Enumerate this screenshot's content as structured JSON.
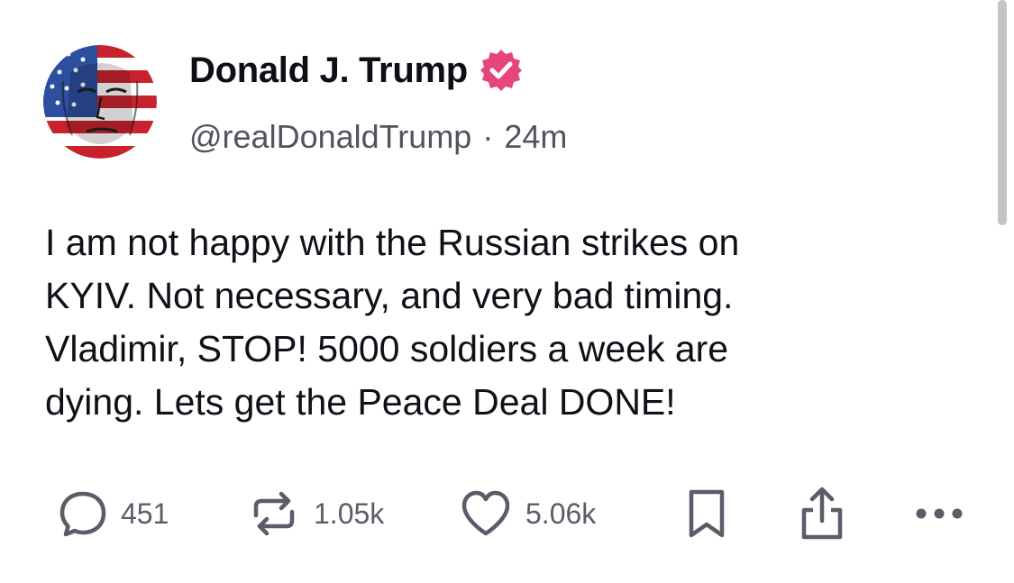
{
  "post": {
    "author": {
      "display_name": "Donald J. Trump",
      "handle": "@realDonaldTrump",
      "verified_icon": "verified-badge-icon",
      "avatar_icon": "avatar-flag-portrait"
    },
    "separator": "·",
    "timestamp": "24m",
    "text": "I am not happy with the Russian strikes on\nKYIV. Not necessary, and very bad timing.\nVladimir, STOP! 5000 soldiers a week are\ndying. Lets get the Peace Deal DONE!",
    "actions": {
      "reply": {
        "icon": "reply-icon",
        "count": "451"
      },
      "repost": {
        "icon": "repost-icon",
        "count": "1.05k"
      },
      "like": {
        "icon": "heart-icon",
        "count": "5.06k"
      },
      "bookmark": {
        "icon": "bookmark-icon"
      },
      "share": {
        "icon": "share-icon"
      },
      "more": {
        "icon": "more-icon"
      }
    }
  },
  "colors": {
    "verified_badge": "#e6457a",
    "text_primary": "#111018",
    "text_secondary": "#54525f",
    "action_icon": "#5d5b68"
  }
}
